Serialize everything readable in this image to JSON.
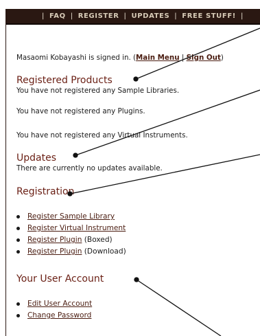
{
  "nav": {
    "items": [
      "FAQ",
      "REGISTER",
      "UPDATES",
      "FREE STUFF!"
    ]
  },
  "status": {
    "user": "Masaomi Kobayashi",
    "signed_in_text": "is signed in. (",
    "main_menu": "Main Menu",
    "divider": "|",
    "sign_out": "Sign Out",
    "close": ")"
  },
  "registered_products": {
    "heading": "Registered Products",
    "lines": [
      "You have not registered any Sample Libraries.",
      "You have not registered any Plugins.",
      "You have not registered any Virtual Instruments."
    ]
  },
  "updates": {
    "heading": "Updates",
    "text": "There are currently no updates available."
  },
  "registration": {
    "heading": "Registration",
    "links": [
      {
        "label": "Register Sample Library",
        "suffix": ""
      },
      {
        "label": "Register Virtual Instrument",
        "suffix": ""
      },
      {
        "label": "Register Plugin",
        "suffix": "(Boxed)"
      },
      {
        "label": "Register Plugin",
        "suffix": "(Download)"
      }
    ]
  },
  "account": {
    "heading": "Your User Account",
    "links": [
      "Edit User Account",
      "Change Password"
    ]
  },
  "colors": {
    "nav_bg": "#2a1812",
    "heading": "#6a1f14",
    "link": "#4a1c10"
  }
}
